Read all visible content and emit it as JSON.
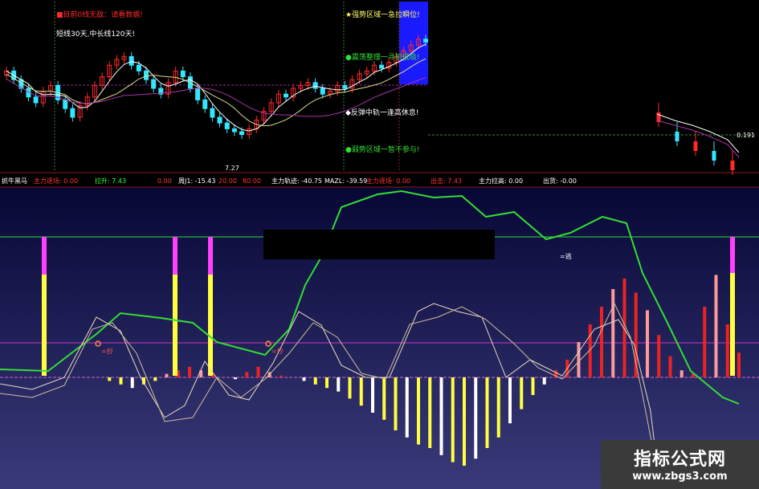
{
  "colors": {
    "bg_top": "#000000",
    "bg_bottom_top": "#070736",
    "bg_bottom_bottom": "#3a3a7a",
    "red": "#ff2a2a",
    "cyan": "#33e6ff",
    "magenta": "#ff40ff",
    "yellow": "#ffff40",
    "green": "#33dd33",
    "white": "#ffffff",
    "pink": "#ff9999",
    "blue_zone": "#1a1aff"
  },
  "top_panel": {
    "annot_left_1": "■目前0线无敌：请看数据!",
    "annot_left_2": "短线30天,中长线120天!",
    "annot_right_1": "★强势区域一急拉瞬位!",
    "annot_right_2": "●震荡整理一寻机低吸!",
    "annot_right_3": "◆反弹中轨一逢高休息!",
    "annot_right_4": "●弱势区域一暂不参与!",
    "price_low_label": "7.27",
    "price_right_label": "0.191"
  },
  "indicator_bar": {
    "items": [
      {
        "text": "抓牛黑马",
        "color": "#ffffff"
      },
      {
        "text": "主力逐场: 0.00",
        "color": "#ff3333"
      },
      {
        "text": "拉升: 7.43",
        "color": "#33ff33"
      },
      {
        "text": "0.00",
        "color": "#ff3333"
      },
      {
        "text": "周J1: -15.43",
        "color": "#ffffff"
      },
      {
        "text": "20.00",
        "color": "#ff3333"
      },
      {
        "text": "80.00",
        "color": "#ff3333"
      },
      {
        "text": "主力轨迹: -40.75",
        "color": "#ffffff"
      },
      {
        "text": "MAZL: -39.59",
        "color": "#ffffff"
      },
      {
        "text": "主力逐场: 0.00",
        "color": "#ff3333"
      },
      {
        "text": "出击: 7.43",
        "color": "#ff3333"
      },
      {
        "text": "主力拉高: 0.00",
        "color": "#ffffff"
      },
      {
        "text": "出货: -0.00",
        "color": "#ffffff"
      }
    ]
  },
  "bottom_panel": {
    "label_zhu_1": "=抄",
    "label_zhu_2": "=抄",
    "label_tao": "=逃"
  },
  "watermark": {
    "cn": "指标公式网",
    "url": "www.zbgs3.com"
  },
  "chart_data": [
    {
      "type": "candlestick",
      "title": "",
      "note": "Approximate price path in chart value units (0-100 relative scale); up/down inferred by color",
      "series": [
        {
          "name": "",
          "values": [
            62,
            56,
            50,
            44,
            40,
            48,
            52,
            42,
            36,
            30,
            38,
            44,
            52,
            58,
            66,
            70,
            72,
            66,
            62,
            56,
            50,
            46,
            54,
            62,
            58,
            50,
            42,
            36,
            30,
            26,
            22,
            20,
            18,
            22,
            28,
            34,
            40,
            46,
            44,
            50,
            52,
            54,
            50,
            46,
            48,
            52,
            50,
            56,
            60,
            62,
            66,
            64,
            68,
            72,
            76,
            80,
            84,
            82
          ]
        },
        {
          "name": "",
          "values": [
            18,
            14,
            12,
            10,
            8
          ]
        }
      ]
    },
    {
      "type": "bar",
      "title": "",
      "note": "Histogram approx values; positive=red/white bars, negative=yellow/white bars",
      "values": [
        0,
        -2,
        -4,
        -6,
        -4,
        -2,
        2,
        4,
        6,
        4,
        2,
        0,
        -1,
        3,
        6,
        3,
        1,
        0,
        -2,
        -4,
        -6,
        -8,
        -12,
        -16,
        -20,
        -24,
        -30,
        -34,
        -38,
        -40,
        -44,
        -48,
        -50,
        -46,
        -40,
        -34,
        -26,
        -18,
        -10,
        -4,
        4,
        10,
        20,
        30,
        40,
        50,
        56,
        48,
        38,
        24,
        12,
        4,
        2,
        40,
        58,
        30,
        14
      ]
    }
  ]
}
